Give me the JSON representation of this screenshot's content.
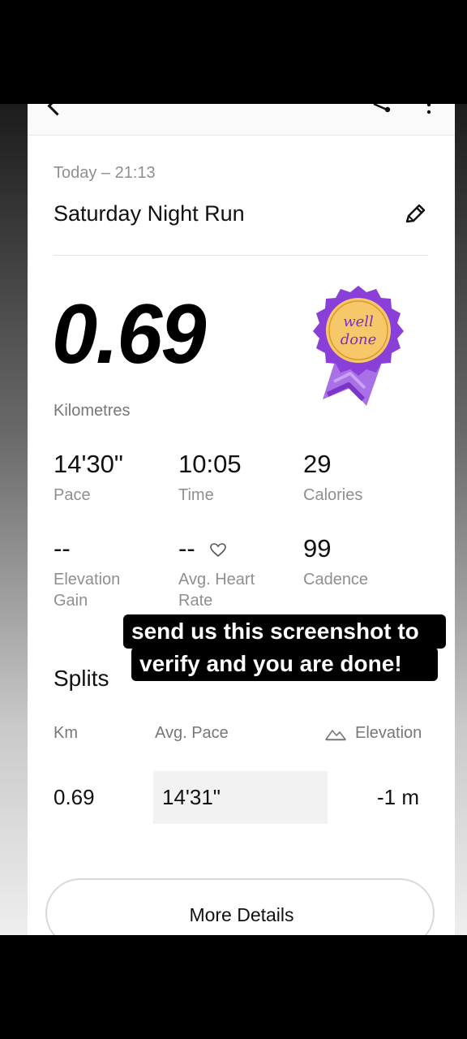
{
  "activity": {
    "date": "Today – 21:13",
    "title": "Saturday Night Run",
    "distance": "0.69",
    "distance_unit": "Kilometres"
  },
  "badge": {
    "text_line1": "well",
    "text_line2": "done"
  },
  "stats": {
    "pace": {
      "value": "14'30\"",
      "label": "Pace"
    },
    "time": {
      "value": "10:05",
      "label": "Time"
    },
    "calories": {
      "value": "29",
      "label": "Calories"
    },
    "elevation_gain": {
      "value": "--",
      "label_line1": "Elevation",
      "label_line2": "Gain"
    },
    "avg_heart_rate": {
      "value": "--",
      "label_line1": "Avg. Heart",
      "label_line2": "Rate"
    },
    "cadence": {
      "value": "99",
      "label": "Cadence"
    }
  },
  "splits": {
    "title": "Splits",
    "columns": [
      "Km",
      "Avg. Pace",
      "Elevation"
    ],
    "rows": [
      {
        "km": "0.69",
        "pace": "14'31\"",
        "elevation": "-1 m"
      }
    ]
  },
  "more_details_label": "More Details",
  "caption": {
    "line1": "send us this screenshot to",
    "line2": "verify and you are done!"
  },
  "colors": {
    "badge_gold": "#F6C86A",
    "badge_purple": "#8B3FD9",
    "badge_ribbon": "#A970E8"
  },
  "icons": [
    "back-arrow-icon",
    "share-icon",
    "more-vert-icon",
    "pencil-icon",
    "heart-icon",
    "elevation-icon"
  ]
}
